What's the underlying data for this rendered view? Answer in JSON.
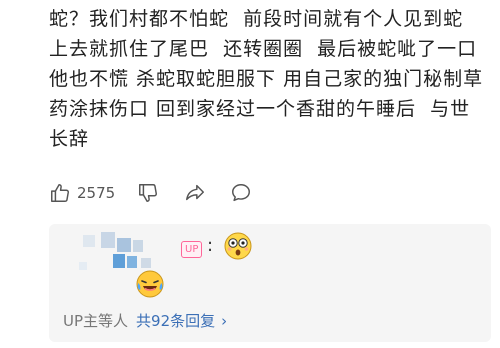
{
  "comment": {
    "lines": [
      "蛇？我们村都不怕蛇  前段时间就有个人见到蛇",
      "上去就抓住了尾巴  还转圈圈  最后被蛇呲了一口",
      "他也不慌 杀蛇取蛇胆服下 用自己家的独门秘制草",
      "药涂抹伤口 回到家经过一个香甜的午睡后  与世",
      "长辞"
    ]
  },
  "actions": {
    "like_icon": "thumbs-up-icon",
    "like_count": "2575",
    "dislike_icon": "thumbs-down-icon",
    "share_icon": "share-icon",
    "reply_icon": "comment-icon"
  },
  "reply": {
    "badge": "UP",
    "colon": ":",
    "emoji_1": "surprised-face-emoji",
    "emoji_2": "laughing-crying-face-emoji",
    "footer_author": "UP主等人",
    "footer_count": "共92条回复",
    "footer_chevron": "›"
  },
  "colors": {
    "link": "#3b6fb6",
    "up_badge": "#ff6699",
    "reply_bg": "#f5f5f5"
  }
}
